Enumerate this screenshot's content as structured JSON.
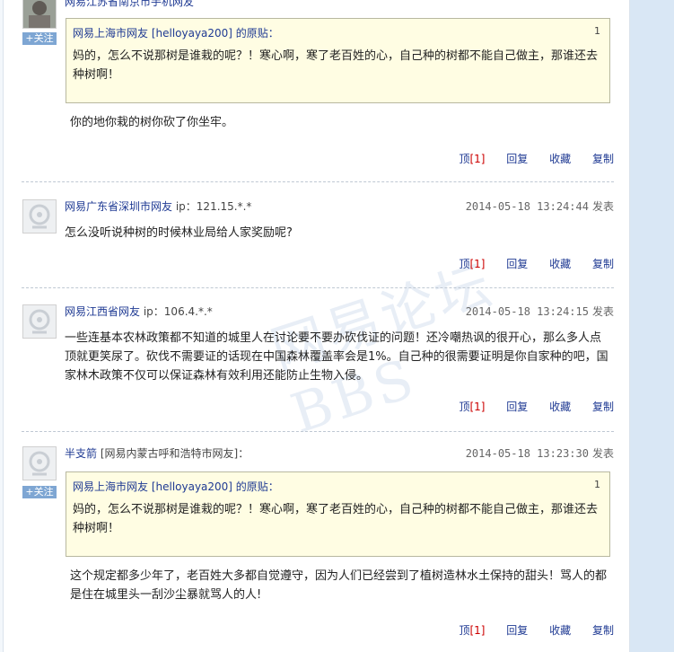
{
  "watermark": "网易论坛 BBS",
  "follow_label": "关注",
  "actions": {
    "top_label": "顶",
    "reply_label": "回复",
    "fav_label": "收藏",
    "copy_label": "复制"
  },
  "posts": [
    {
      "user": "网易江苏省南京市手机网友",
      "time": "",
      "quote": {
        "header": "网易上海市网友 [helloyaya200] 的原贴：",
        "num": "1",
        "text": "妈的，怎么不说那树是谁栽的呢？！寒心啊，寒了老百姓的心，自己种的树都不能自己做主，那谁还去种树啊！"
      },
      "body": "你的地你栽的树你砍了你坐牢。",
      "top_count": "[1]"
    },
    {
      "user": "网易广东省深圳市网友",
      "ip": "ip：121.15.*.*",
      "time": "2014-05-18 13:24:44",
      "pub": "发表",
      "body": "怎么没听说种树的时候林业局给人家奖励呢?",
      "top_count": "[1]"
    },
    {
      "user": "网易江西省网友",
      "ip": "ip：106.4.*.*",
      "time": "2014-05-18 13:24:15",
      "pub": "发表",
      "body": "一些连基本农林政策都不知道的城里人在讨论要不要办砍伐证的问题！还冷嘲热讽的很开心，那么多人点顶就更笑尿了。砍伐不需要证的话现在中国森林覆盖率会是1%。自己种的很需要证明是你自家种的吧，国家林木政策不仅可以保证森林有效利用还能防止生物入侵。",
      "top_count": "[1]"
    },
    {
      "user": "半支箭",
      "loc": "[网易内蒙古呼和浩特市网友]：",
      "time": "2014-05-18 13:23:30",
      "pub": "发表",
      "quote": {
        "header": "网易上海市网友 [helloyaya200] 的原贴：",
        "num": "1",
        "text": "妈的，怎么不说那树是谁栽的呢？！寒心啊，寒了老百姓的心，自己种的树都不能自己做主，那谁还去种树啊！"
      },
      "body": "这个规定都多少年了，老百姓大多都自觉遵守，因为人们已经尝到了植树造林水土保持的甜头！骂人的都是住在城里头一刮沙尘暴就骂人的人!",
      "top_count": "[1]"
    }
  ]
}
